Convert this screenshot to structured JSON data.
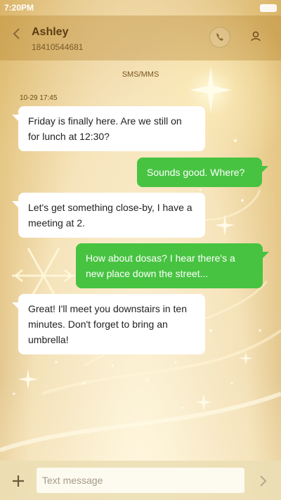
{
  "status_bar": {
    "time": "7:20PM"
  },
  "header": {
    "contact_name": "Ashley",
    "contact_number": "18410544681",
    "icons": {
      "back": "chevron-left-icon",
      "call": "phone-icon",
      "profile": "person-icon"
    }
  },
  "conversation": {
    "channel_label": "SMS/MMS",
    "timestamp": "10-29 17:45",
    "messages": [
      {
        "direction": "incoming",
        "text": "Friday is finally here. Are we still on for lunch at 12:30?"
      },
      {
        "direction": "outgoing",
        "text": "Sounds good. Where?"
      },
      {
        "direction": "incoming",
        "text": "Let's get something close-by, I have a meeting at 2."
      },
      {
        "direction": "outgoing",
        "text": "How about dosas? I hear there's a new place down the street..."
      },
      {
        "direction": "incoming",
        "text": "Great! I'll meet you downstairs in ten minutes. Don't forget to bring an umbrella!"
      }
    ]
  },
  "composer": {
    "placeholder": "Text message",
    "value": "",
    "icons": {
      "add": "plus-icon",
      "send": "chevron-right-icon"
    }
  },
  "colors": {
    "incoming_bubble": "#ffffff",
    "outgoing_bubble": "#47c341",
    "wallpaper": "#c99a2a"
  }
}
